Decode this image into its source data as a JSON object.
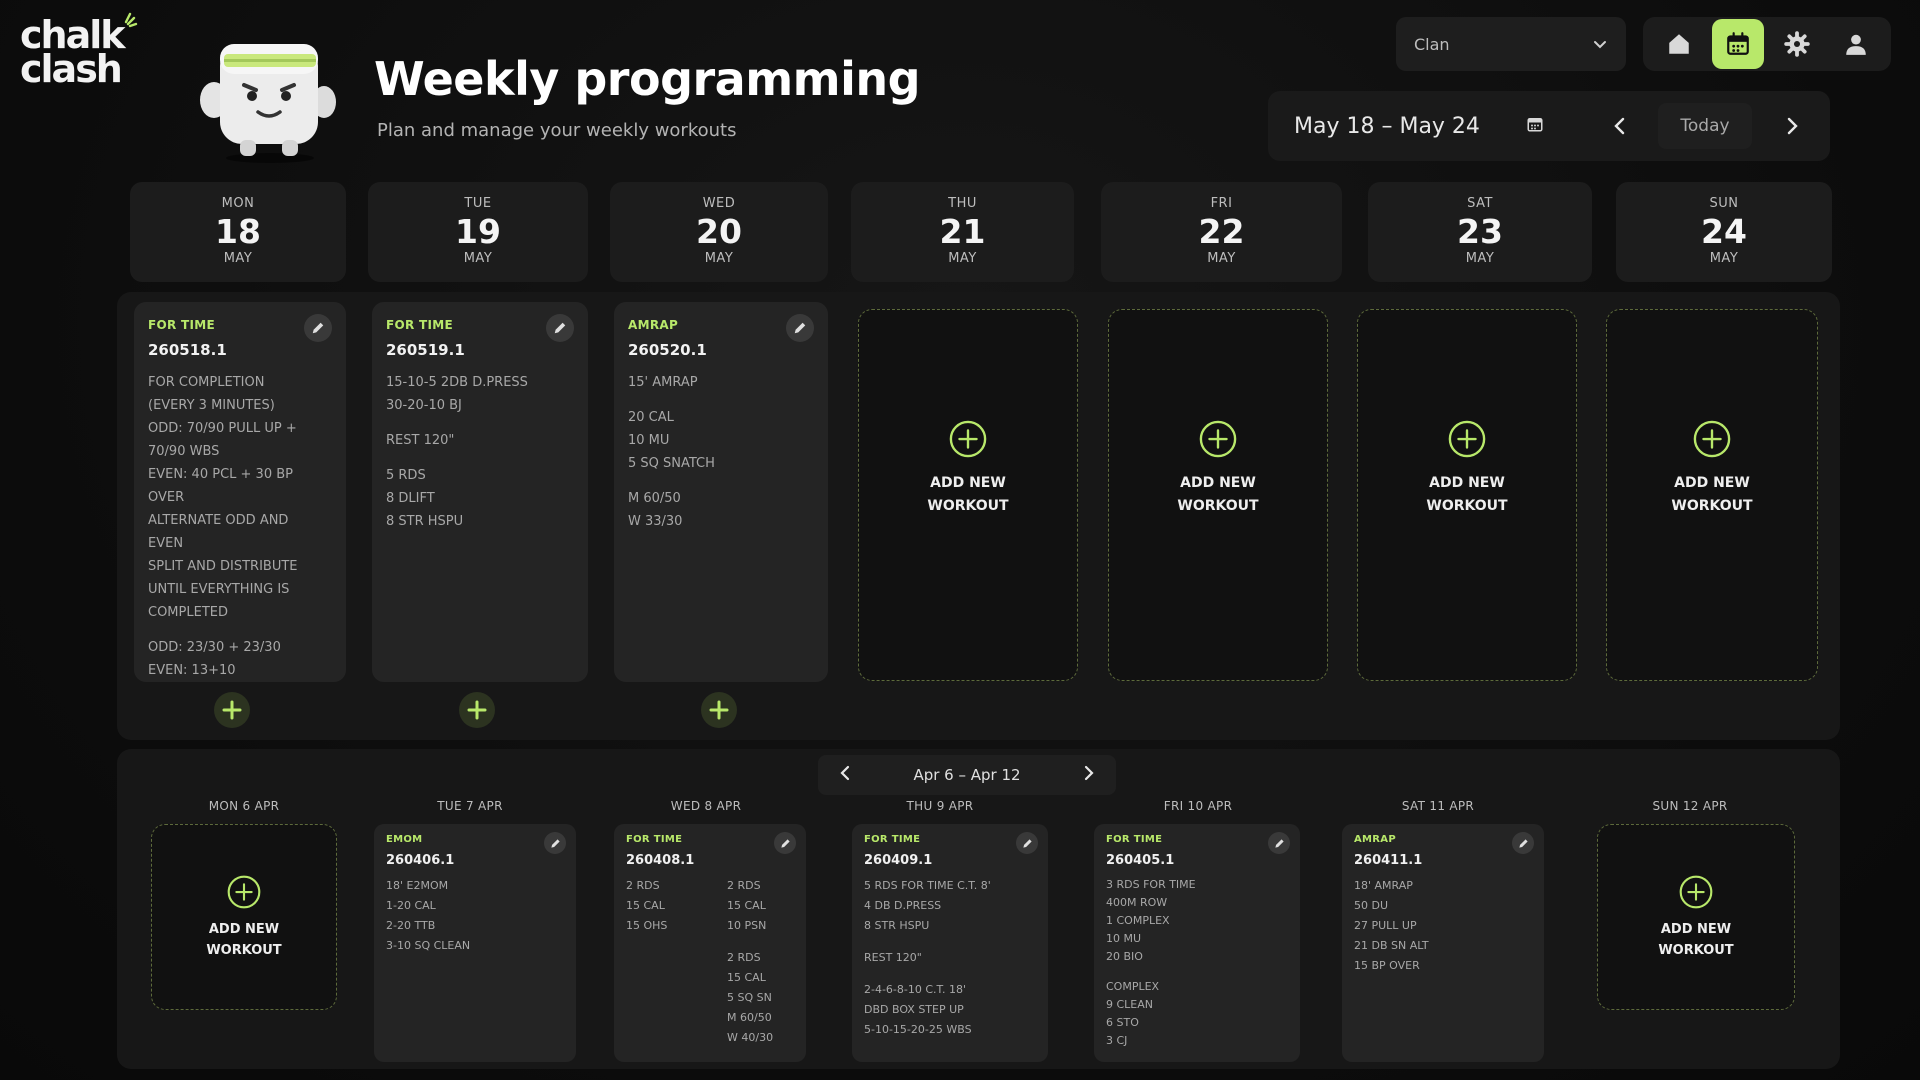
{
  "brand": {
    "logo_line1": "chalk",
    "logo_line2": "clash"
  },
  "header": {
    "title": "Weekly programming",
    "subtitle": "Plan and manage your weekly workouts"
  },
  "clan_select": {
    "value": "Clan"
  },
  "nav": {
    "icons": [
      "home-icon",
      "calendar-icon",
      "gear-icon",
      "user-icon"
    ],
    "active": "calendar-icon"
  },
  "week_nav": {
    "range": "May 18 – May 24",
    "today_label": "Today"
  },
  "colors": {
    "accent": "#b8e86a",
    "panel": "#171717",
    "card": "#242424"
  },
  "days": [
    {
      "dow": "MON",
      "num": "18",
      "month": "MAY"
    },
    {
      "dow": "TUE",
      "num": "19",
      "month": "MAY"
    },
    {
      "dow": "WED",
      "num": "20",
      "month": "MAY"
    },
    {
      "dow": "THU",
      "num": "21",
      "month": "MAY"
    },
    {
      "dow": "FRI",
      "num": "22",
      "month": "MAY"
    },
    {
      "dow": "SAT",
      "num": "23",
      "month": "MAY"
    },
    {
      "dow": "SUN",
      "num": "24",
      "month": "MAY"
    }
  ],
  "workouts": [
    {
      "type": "FOR TIME",
      "code": "260518.1",
      "lines": [
        "FOR COMPLETION",
        "(EVERY 3 MINUTES)",
        "ODD: 70/90 PULL UP +",
        "70/90 WBS",
        "EVEN: 40 PCL + 30 BP",
        "OVER",
        "ALTERNATE ODD AND",
        "EVEN",
        "SPLIT AND DISTRIBUTE",
        "UNTIL EVERYTHING IS",
        "COMPLETED",
        "",
        "ODD: 23/30 + 23/30",
        "EVEN: 13+10"
      ]
    },
    {
      "type": "FOR TIME",
      "code": "260519.1",
      "lines": [
        "15-10-5 2DB D.PRESS",
        "30-20-10 BJ",
        "",
        "REST 120\"",
        "",
        "5 RDS",
        "8 DLIFT",
        "8 STR HSPU"
      ]
    },
    {
      "type": "AMRAP",
      "code": "260520.1",
      "lines": [
        "15' AMRAP",
        "",
        "20 CAL",
        "10 MU",
        "5 SQ SNATCH",
        "",
        "M 60/50",
        "W 33/30"
      ]
    }
  ],
  "empty_label": {
    "line1": "ADD NEW",
    "line2": "WORKOUT"
  },
  "lower": {
    "range": "Apr 6 – Apr 12",
    "days": [
      "MON 6 APR",
      "TUE 7 APR",
      "WED 8 APR",
      "THU 9 APR",
      "FRI 10 APR",
      "SAT 11 APR",
      "SUN 12 APR"
    ],
    "cards": [
      {
        "type": "EMOM",
        "code": "260406.1",
        "lines": [
          "18' E2MOM",
          "1-20 CAL",
          "2-20 TTB",
          "3-10 SQ CLEAN"
        ]
      },
      {
        "type": "FOR TIME",
        "code": "260408.1",
        "col1": [
          "2 RDS",
          "15 CAL",
          "15 OHS"
        ],
        "col2": [
          "2 RDS",
          "15 CAL",
          "10 PSN",
          "",
          "2 RDS",
          "15 CAL",
          "5 SQ SN",
          "M 60/50",
          "W 40/30"
        ]
      },
      {
        "type": "FOR TIME",
        "code": "260409.1",
        "lines": [
          "5 RDS FOR TIME C.T. 8'",
          "4 DB D.PRESS",
          "8 STR HSPU",
          "",
          "REST 120\"",
          "",
          "2-4-6-8-10 C.T. 18'",
          "DBD BOX STEP UP",
          "5-10-15-20-25 WBS"
        ]
      },
      {
        "type": "FOR TIME",
        "code": "260405.1",
        "lines": [
          "3 RDS FOR TIME",
          "400m ROW",
          "1 COMPLEX",
          "10 MU",
          "20 BIO",
          "",
          "COMPLEX",
          "9 CLEAN",
          "6 STO",
          "3 CJ"
        ]
      },
      {
        "type": "AMRAP",
        "code": "260411.1",
        "lines": [
          "18' AMRAP",
          "50 DU",
          "27 PULL UP",
          "21 DB SN ALT",
          "15 BP OVER"
        ]
      }
    ]
  }
}
